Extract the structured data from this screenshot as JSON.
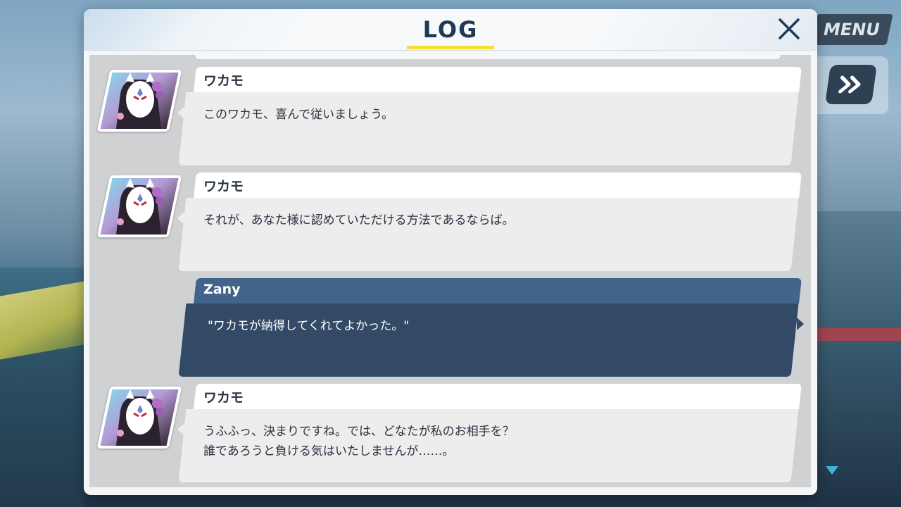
{
  "header": {
    "title": "LOG"
  },
  "hud": {
    "menu_label": "MENU",
    "fast_forward_icon": "fast-forward-icon",
    "close_icon": "close-icon",
    "scroll_down_icon": "triangle-down-icon"
  },
  "entries": [
    {
      "speaker": "ワカモ",
      "text": "このワカモ、喜んで従いましょう。",
      "type": "npc"
    },
    {
      "speaker": "ワカモ",
      "text": "それが、あなた様に認めていただける方法であるならば。",
      "type": "npc"
    },
    {
      "speaker": "Zany",
      "text": "\"ワカモが納得してくれてよかった。\"",
      "type": "player"
    },
    {
      "speaker": "ワカモ",
      "text": "うふふっ、決まりですね。では、どなたが私のお相手を？\n誰であろうと負ける気はいたしませんが……。",
      "type": "npc"
    }
  ],
  "colors": {
    "accent_underline": "#f3e12e",
    "title": "#1f3a56",
    "player_name_bar": "#42648a",
    "player_msg": "#334a66"
  }
}
